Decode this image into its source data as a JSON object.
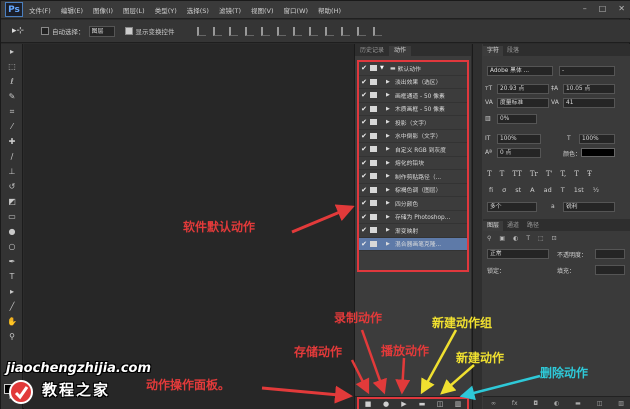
{
  "app": {
    "logo": "Ps"
  },
  "menu": [
    "文件(F)",
    "编辑(E)",
    "图像(I)",
    "图层(L)",
    "类型(Y)",
    "选择(S)",
    "滤镜(T)",
    "视图(V)",
    "窗口(W)",
    "帮助(H)"
  ],
  "window_controls": [
    "–",
    "□",
    "✕"
  ],
  "options_bar": {
    "auto_select_label": "自动选择：",
    "auto_select_value": "图层",
    "show_transform_label": "显示变换控件"
  },
  "actions_panel": {
    "tabs": [
      "历史记录",
      "动作"
    ],
    "active_tab": "动作",
    "items": [
      {
        "label": "默认动作",
        "type": "set"
      },
      {
        "label": "淡出效果（选区）",
        "type": "action"
      },
      {
        "label": "画框通道 - 50 像素",
        "type": "action"
      },
      {
        "label": "木质画框 - 50 像素",
        "type": "action"
      },
      {
        "label": "投影（文字）",
        "type": "action"
      },
      {
        "label": "水中倒影（文字）",
        "type": "action"
      },
      {
        "label": "自定义 RGB 到灰度",
        "type": "action"
      },
      {
        "label": "熔化的铅块",
        "type": "action"
      },
      {
        "label": "制作剪贴路径（...",
        "type": "action"
      },
      {
        "label": "棕褐色调（图层）",
        "type": "action"
      },
      {
        "label": "四分颜色",
        "type": "action"
      },
      {
        "label": "存储为 Photoshop...",
        "type": "action"
      },
      {
        "label": "渐变映射",
        "type": "action"
      },
      {
        "label": "混合器画笔克隆...",
        "type": "action",
        "selected": true
      }
    ],
    "footer_icons": [
      "stop-icon",
      "record-icon",
      "play-icon",
      "new-set-icon",
      "new-action-icon",
      "delete-icon"
    ]
  },
  "character_panel": {
    "tabs": [
      "字符",
      "段落"
    ],
    "font_family": "Adobe 黑体 ...",
    "font_style": "-",
    "font_size": "20.93 点",
    "leading": "10.05 点",
    "kerning": "度量标准",
    "tracking": "41",
    "vertical_scale_pct": "0%",
    "scale_v": "100%",
    "scale_h": "100%",
    "baseline": "0 点",
    "color_label": "颜色：",
    "styles": [
      "T",
      "T",
      "TT",
      "Tr",
      "T'",
      "T,",
      "T",
      "Ŧ"
    ],
    "opentype": [
      "fi",
      "σ",
      "st",
      "A",
      "ad",
      "T",
      "1st",
      "½"
    ],
    "language": "美国英语",
    "antialias": "锐利",
    "lang_prefix": "a",
    "lang_short": "多个"
  },
  "layers_panel": {
    "tabs": [
      "图层",
      "通道",
      "路径"
    ],
    "blend_mode": "正常",
    "opacity_label": "不透明度：",
    "lock_label": "锁定：",
    "fill_label": "填充："
  },
  "annotations": {
    "default_actions": "软件默认动作",
    "record": "录制动作",
    "save": "存储动作",
    "play": "播放动作",
    "new_set": "新建动作组",
    "new_action": "新建动作",
    "delete": "删除动作",
    "panel": "动作操作面板。"
  },
  "watermark": {
    "url": "jiaochengzhijia.com",
    "name": "教程之家"
  },
  "colors": {
    "annotation_red": "#e23a3a",
    "annotation_yellow": "#f0e030",
    "annotation_cyan": "#2ec9d8",
    "selected_row": "#5e7aa8"
  }
}
